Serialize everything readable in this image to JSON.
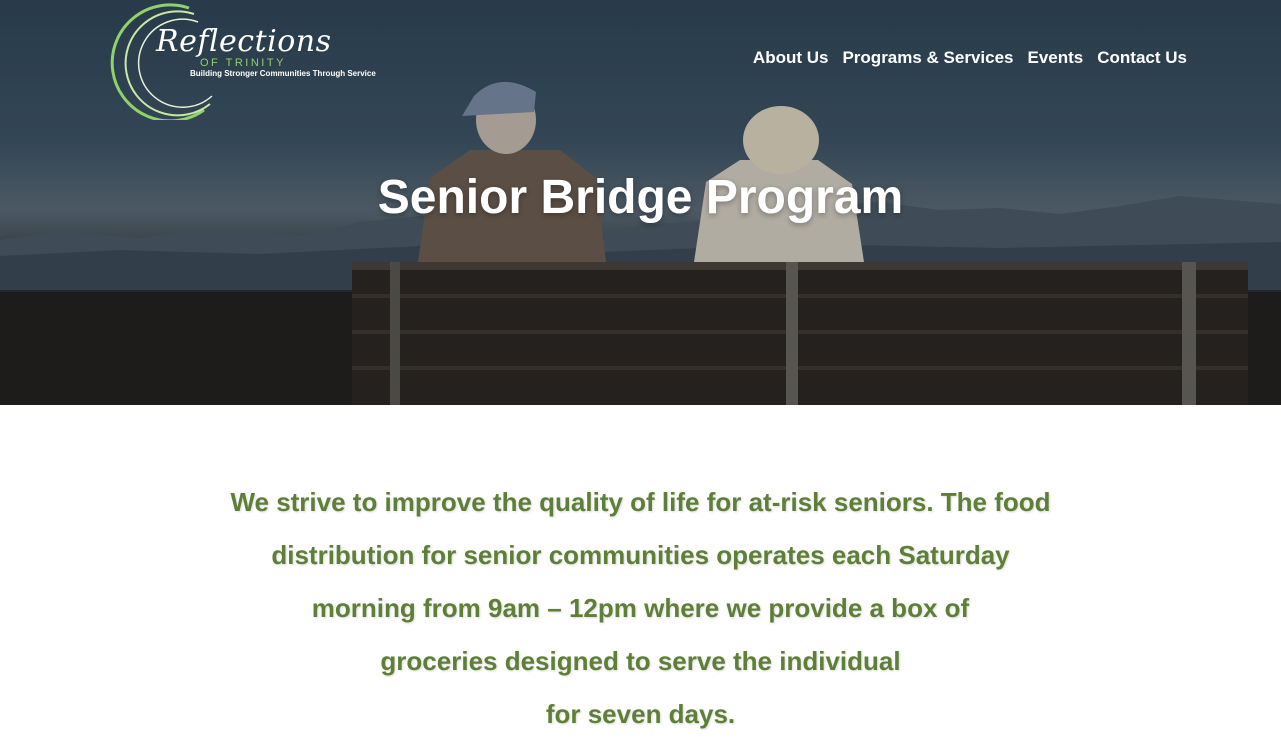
{
  "logo": {
    "title": "Reflections",
    "subtitle": "OF TRINITY",
    "tagline": "Building Stronger Communities Through Service"
  },
  "nav": {
    "items": [
      "About Us",
      "Programs & Services",
      "Events",
      "Contact Us"
    ]
  },
  "hero": {
    "title": "Senior Bridge Program"
  },
  "content": {
    "lines": [
      "We strive to improve the quality of life for at-risk seniors. The food",
      "distribution for senior communities operates each Saturday",
      "morning from 9am – 12pm where we provide a box of",
      "groceries designed to serve the individual",
      "for seven days."
    ]
  },
  "colors": {
    "accent_green": "#5e7f38",
    "logo_green": "#8fd16a"
  }
}
